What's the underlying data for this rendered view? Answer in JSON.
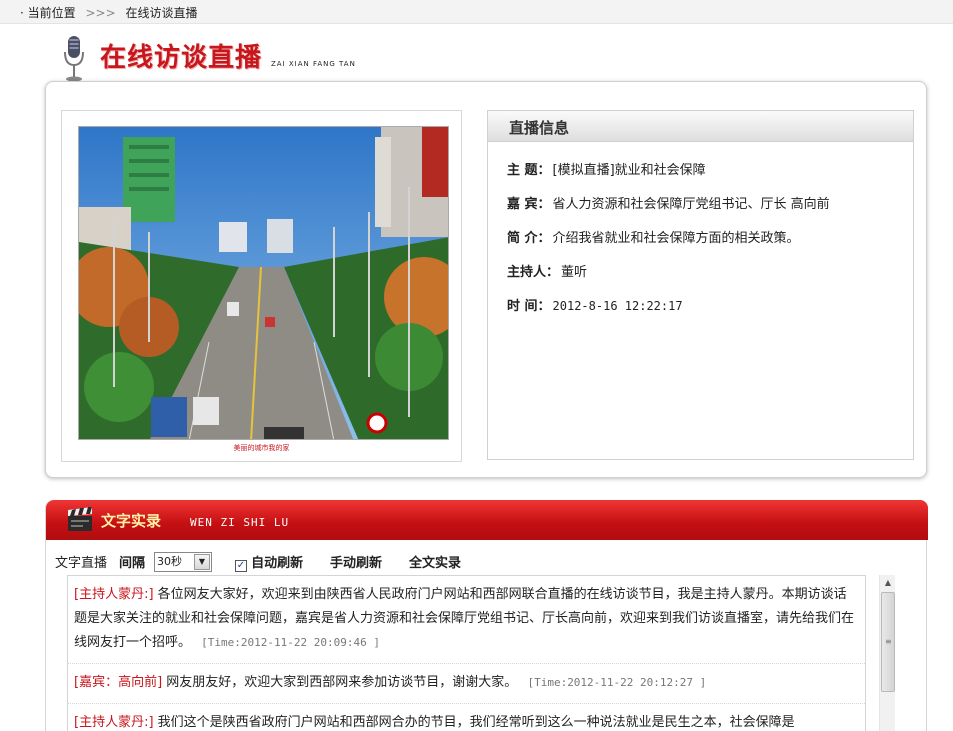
{
  "breadcrumb": {
    "bullet": "·",
    "current_position_label": "当前位置",
    "separator": ">>>",
    "page": "在线访谈直播"
  },
  "header": {
    "title_cn": "在线访谈直播",
    "title_en": "ZAI XIAN FANG TAN",
    "icon": "microphone-icon"
  },
  "photo": {
    "caption": "美丽的城市我的家"
  },
  "live_info": {
    "heading": "直播信息",
    "rows": [
      {
        "label": "主 题：",
        "value": "[模拟直播]就业和社会保障"
      },
      {
        "label": "嘉 宾：",
        "value": "省人力资源和社会保障厅党组书记、厅长 高向前"
      },
      {
        "label": "简 介：",
        "value": "介绍我省就业和社会保障方面的相关政策。"
      },
      {
        "label": "主持人：",
        "value": "董听"
      },
      {
        "label": "时 间：",
        "value": "2012-8-16 12:22:17"
      }
    ]
  },
  "transcript": {
    "title_cn": "文字实录",
    "title_en": "WEN ZI SHI LU",
    "icon": "clapperboard-icon",
    "controls": {
      "live_text_label": "文字直播",
      "interval_label": "间隔",
      "interval_value": "30秒",
      "auto_refresh_label": "自动刷新",
      "auto_refresh_checked": true,
      "manual_refresh_label": "手动刷新",
      "full_record_label": "全文实录"
    },
    "entries": [
      {
        "speaker": "[主持人蒙丹:]",
        "text": "各位网友大家好，欢迎来到由陕西省人民政府门户网站和西部网联合直播的在线访谈节目，我是主持人蒙丹。本期访谈话题是大家关注的就业和社会保障问题，嘉宾是省人力资源和社会保障厅党组书记、厅长高向前，欢迎来到我们访谈直播室，请先给我们在线网友打一个招呼。",
        "time": "[Time:2012-11-22 20:09:46 ]"
      },
      {
        "speaker": "[嘉宾：高向前]",
        "text": "网友朋友好，欢迎大家到西部网来参加访谈节目，谢谢大家。",
        "time": "[Time:2012-11-22 20:12:27 ]"
      },
      {
        "speaker": "[主持人蒙丹:]",
        "text": "我们这个是陕西省政府门户网站和西部网合办的节目，我们经常听到这么一种说法就业是民生之本，社会保障是",
        "time": ""
      }
    ]
  },
  "colors": {
    "brand_red": "#c8161d",
    "header_red": "#c40f12",
    "title_gold": "#fff1a8"
  }
}
